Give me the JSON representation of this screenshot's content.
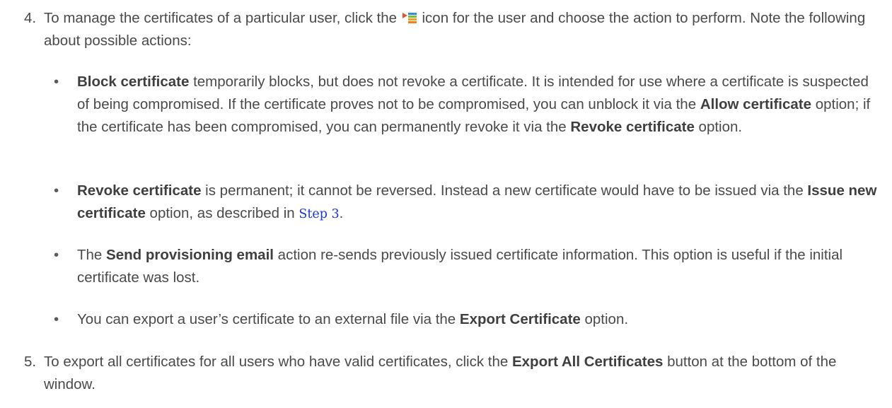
{
  "step4": {
    "number": "4.",
    "text_before_icon": "To manage the certificates of a particular user, click the",
    "text_after_icon": "icon for the user and choose the action to perform. Note the following about possible actions:",
    "icon_name": "actions-menu-icon",
    "bullets": [
      {
        "bold": "Block certificate",
        "text_1": " temporarily blocks, but does not revoke a certificate. It is intended for use where a certificate is suspected of being compromised. If the certificate proves not to be compromised, you can unblock it via the ",
        "bold_2": "Allow certificate",
        "text_2": " option; if the certificate has been compromised, you can permanently revoke it via the ",
        "bold_3": "Revoke certificate",
        "text_3": " option."
      },
      {
        "bold": "Revoke certificate",
        "text_1": " is permanent; it cannot be reversed. Instead a new certificate would have to be issued via the ",
        "bold_2": "Issue new certificate",
        "text_2": " option, as described in ",
        "link": "Step 3",
        "text_3": "."
      },
      {
        "text_0": "The ",
        "bold": "Send provisioning email",
        "text_1": " action re-sends previously issued certificate information. This option is useful if the initial certificate was lost."
      },
      {
        "text_0": "You can export a user’s certificate to an external file via the ",
        "bold": "Export Certificate",
        "text_1": " option."
      }
    ]
  },
  "step5": {
    "number": "5.",
    "text_1": "To export all certificates for all users who have valid certificates, click the ",
    "bold": "Export All Certificates",
    "text_2": " button at the bottom of the window."
  },
  "bullet_char": "•"
}
